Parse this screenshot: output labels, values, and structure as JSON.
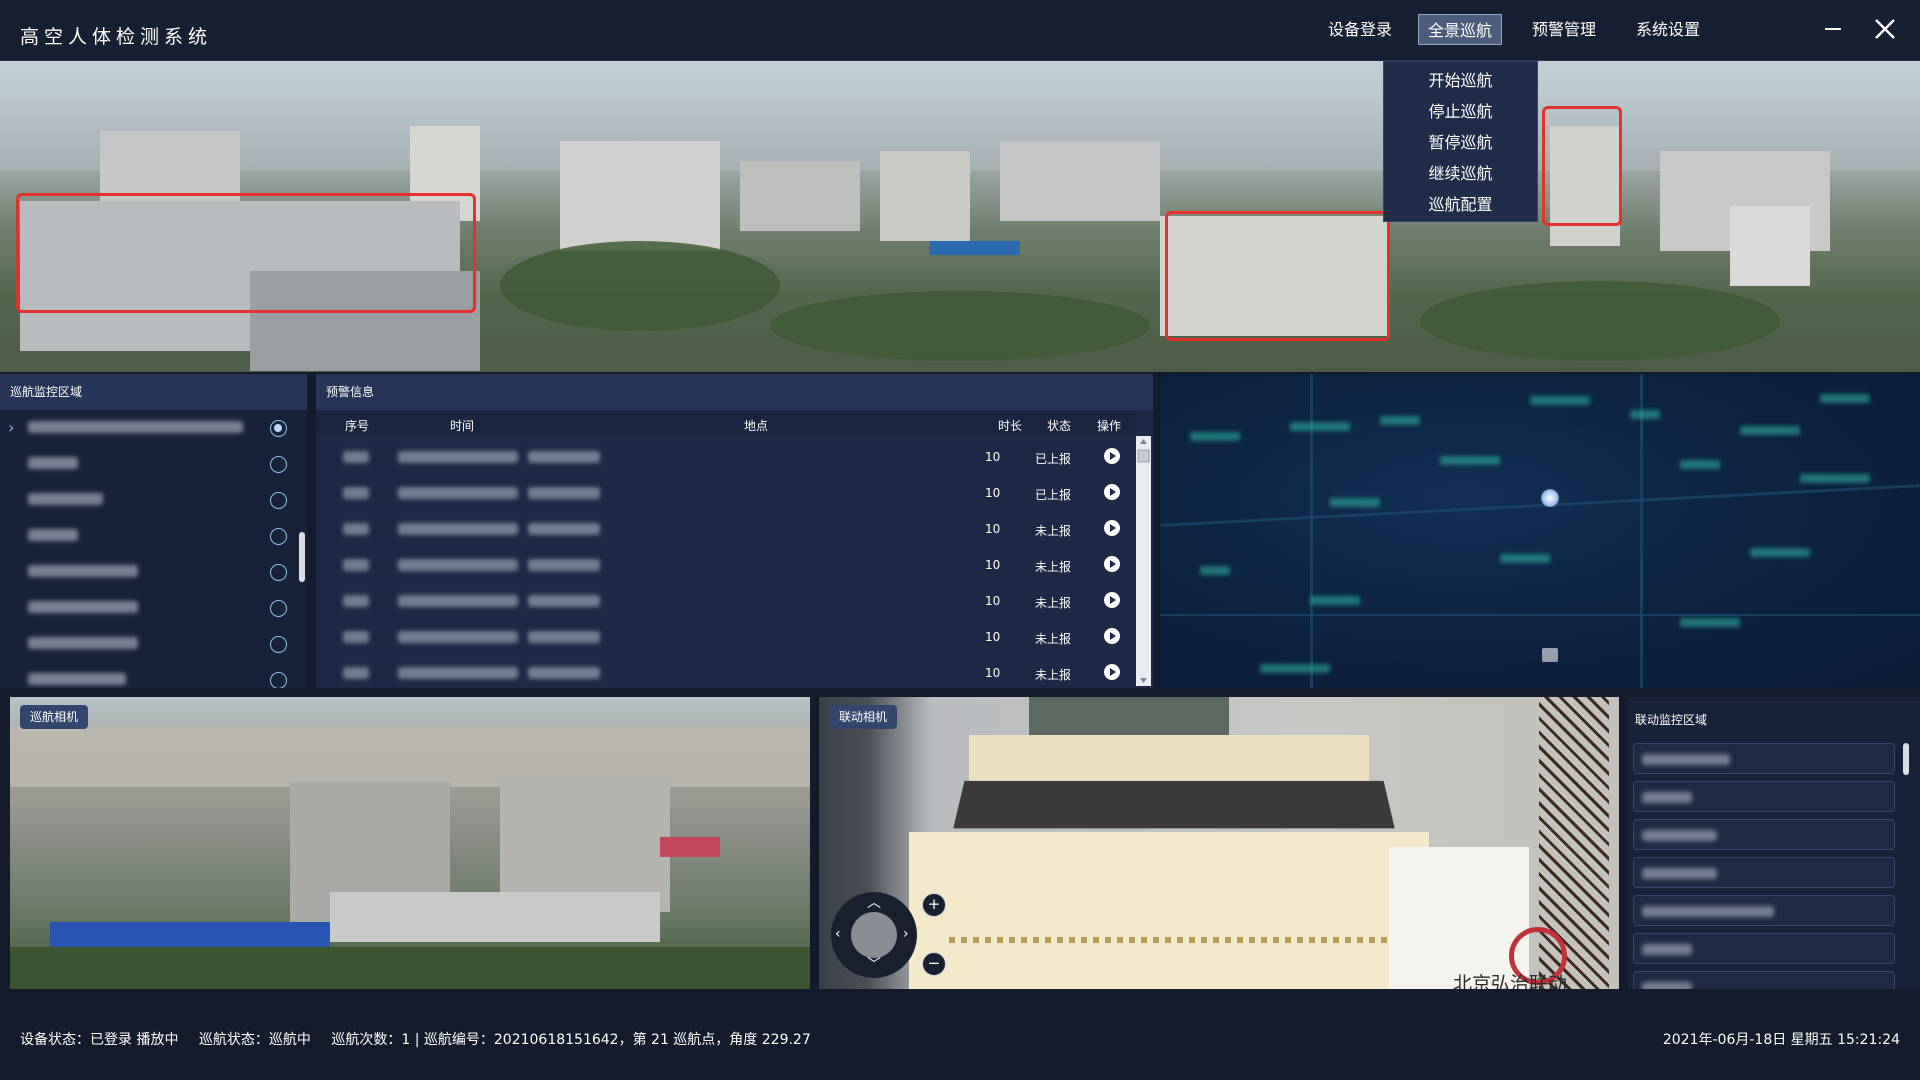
{
  "app": {
    "title": "高空人体检测系统"
  },
  "menu": {
    "items": [
      {
        "label": "设备登录"
      },
      {
        "label": "全景巡航"
      },
      {
        "label": "预警管理"
      },
      {
        "label": "系统设置"
      }
    ],
    "dropdown": [
      "开始巡航",
      "停止巡航",
      "暂停巡航",
      "继续巡航",
      "巡航配置"
    ]
  },
  "patrol_area": {
    "title": "巡航监控区域",
    "selected_index": 0
  },
  "alerts": {
    "title": "预警信息",
    "columns": {
      "index": "序号",
      "time": "时间",
      "location": "地点",
      "duration": "时长",
      "status": "状态",
      "action": "操作"
    },
    "rows": [
      {
        "duration": "10",
        "status": "已上报"
      },
      {
        "duration": "10",
        "status": "已上报"
      },
      {
        "duration": "10",
        "status": "未上报"
      },
      {
        "duration": "10",
        "status": "未上报"
      },
      {
        "duration": "10",
        "status": "未上报"
      },
      {
        "duration": "10",
        "status": "未上报"
      },
      {
        "duration": "10",
        "status": "未上报"
      }
    ]
  },
  "cameras": {
    "patrol_label": "巡航相机",
    "linkage_label": "联动相机",
    "watermark": "北京弘治联动"
  },
  "linkage_area": {
    "title": "联动监控区域"
  },
  "status": {
    "device": "设备状态：已登录 播放中",
    "patrol": "巡航状态：巡航中",
    "count": "巡航次数：1 | 巡航编号：20210618151642，第 21 巡航点，角度 229.27",
    "datetime": "2021年-06月-18日 星期五 15:21:24"
  },
  "colors": {
    "accent_outline": "#e3312c",
    "header_bg": "#172033",
    "panel_head": "#253458"
  }
}
